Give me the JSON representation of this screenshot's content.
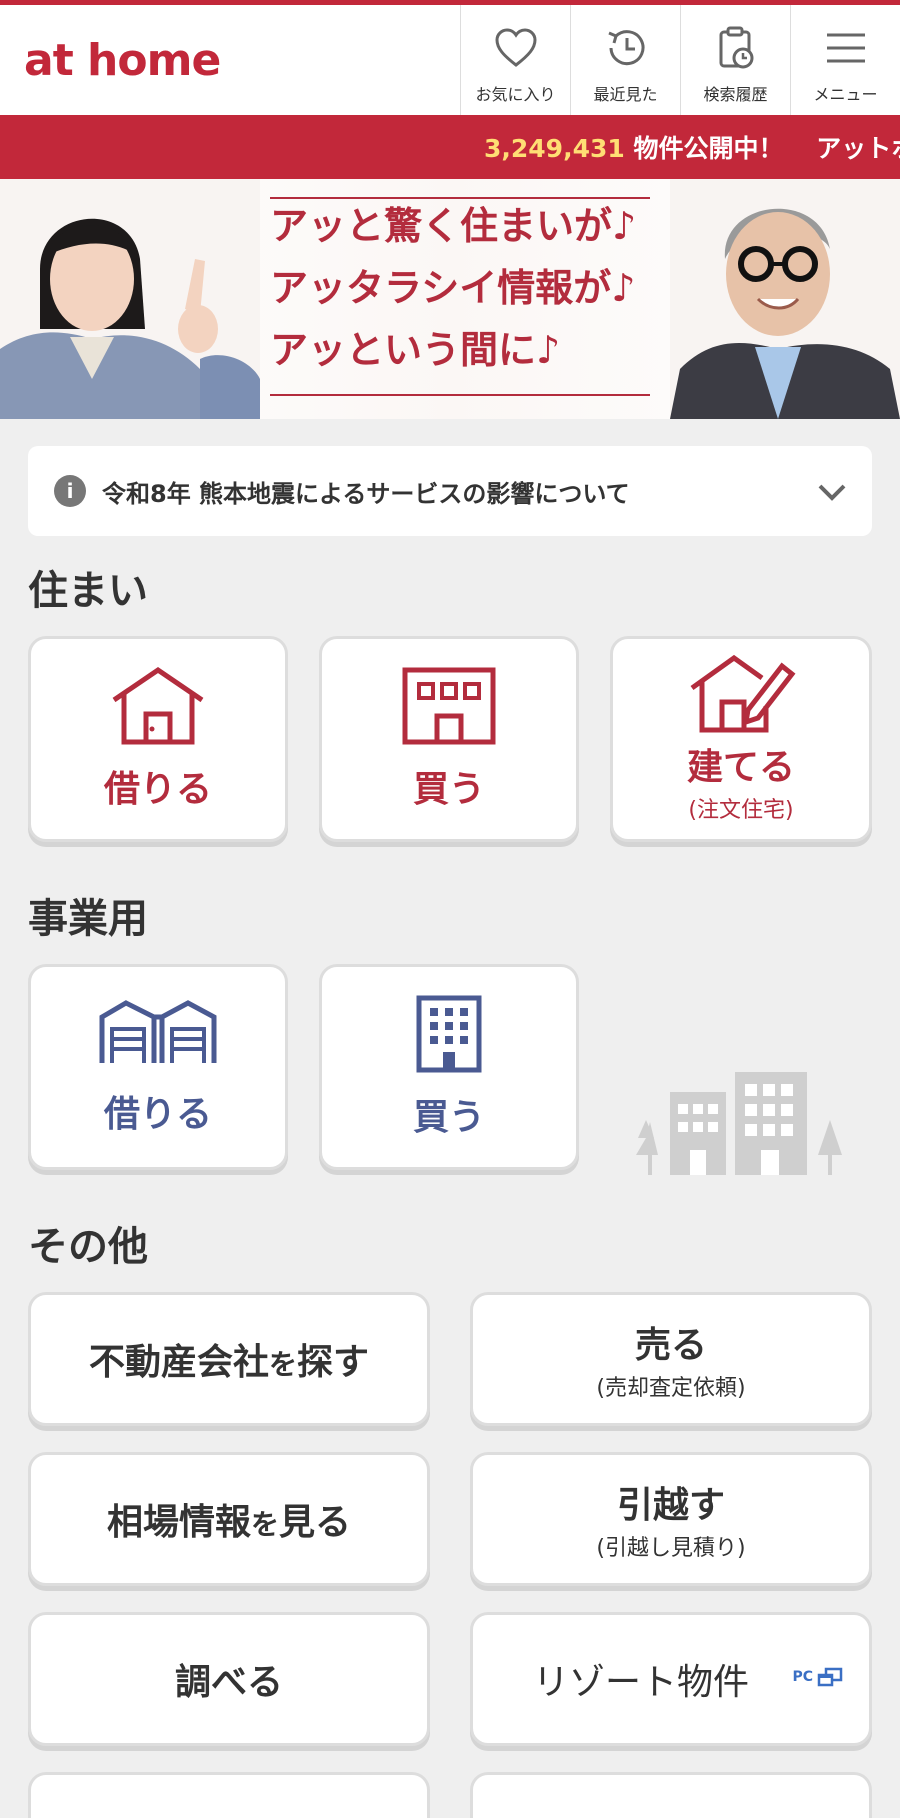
{
  "header": {
    "logo_text": "at home",
    "nav": [
      {
        "label": "お気に入り",
        "icon": "heart-icon"
      },
      {
        "label": "最近見た",
        "icon": "history-clock-icon"
      },
      {
        "label": "検索履歴",
        "icon": "clipboard-clock-icon"
      },
      {
        "label": "メニュー",
        "icon": "hamburger-menu-icon"
      }
    ]
  },
  "ticker": {
    "count": "3,249,431",
    "text": "物件公開中！",
    "more": "アットホ"
  },
  "banner": {
    "lines": [
      "アッと驚く住まいが♪",
      "アッタラシイ情報が♪",
      "アッという間に♪"
    ]
  },
  "notice": {
    "icon": "info-icon",
    "text": "令和8年 熊本地震によるサービスの影響について",
    "chevron": "chevron-down-icon"
  },
  "sections": {
    "housing": {
      "title": "住まい",
      "cards": [
        {
          "label": "借りる",
          "sub": "",
          "icon": "house-icon"
        },
        {
          "label": "買う",
          "sub": "",
          "icon": "building-front-icon"
        },
        {
          "label": "建てる",
          "sub": "(注文住宅)",
          "icon": "house-pencil-icon"
        }
      ]
    },
    "business": {
      "title": "事業用",
      "cards": [
        {
          "label": "借りる",
          "sub": "",
          "icon": "warehouse-icon"
        },
        {
          "label": "買う",
          "sub": "",
          "icon": "office-building-icon"
        }
      ]
    },
    "other": {
      "title": "その他",
      "cards": [
        {
          "label_main": "不動産会社",
          "label_small": "を",
          "label_end": "探す"
        },
        {
          "label": "売る",
          "sub": "(売却査定依頼)"
        },
        {
          "label_main": "相場情報",
          "label_small": "を",
          "label_end": "見る"
        },
        {
          "label": "引越す",
          "sub": "(引越し見積り)"
        },
        {
          "label": "調べる"
        },
        {
          "label": "リゾート物件",
          "badge": "PC"
        }
      ]
    }
  },
  "colors": {
    "brand_red": "#c2283a",
    "business_blue": "#4a5a92",
    "ticker_count": "#ffde74"
  }
}
